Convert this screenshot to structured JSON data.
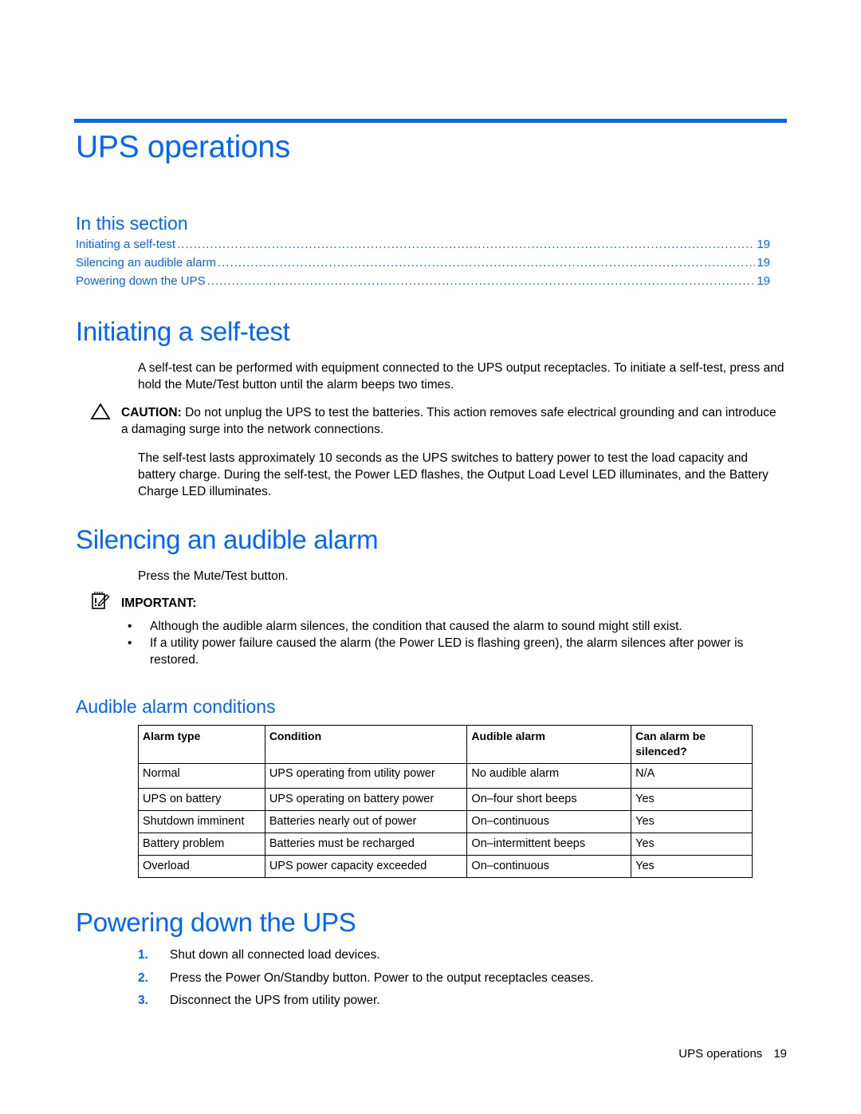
{
  "page": {
    "title": "UPS operations",
    "in_this_section": {
      "heading": "In this section",
      "entries": [
        {
          "label": "Initiating a self-test",
          "page": "19"
        },
        {
          "label": "Silencing an audible alarm",
          "page": "19"
        },
        {
          "label": "Powering down the UPS",
          "page": "19"
        }
      ]
    },
    "self_test": {
      "heading": "Initiating a self-test",
      "intro": "A self-test can be performed with equipment connected to the UPS output receptacles. To initiate a self-test, press and hold the Mute/Test button until the alarm beeps two times.",
      "caution_label": "CAUTION:",
      "caution_text": " Do not unplug the UPS to test the batteries. This action removes safe electrical grounding and can introduce a damaging surge into the network connections.",
      "details": "The self-test lasts approximately 10 seconds as the UPS switches to battery power to test the load capacity and battery charge. During the self-test, the Power LED flashes, the Output Load Level LED illuminates, and the Battery Charge LED illuminates."
    },
    "silencing": {
      "heading": "Silencing an audible alarm",
      "instruction": "Press the Mute/Test button.",
      "important_label": "IMPORTANT:",
      "bullets": [
        "Although the audible alarm silences, the condition that caused the alarm to sound might still exist.",
        "If a utility power failure caused the alarm (the Power LED is flashing green), the alarm silences after power is restored."
      ],
      "conditions": {
        "heading": "Audible alarm conditions",
        "columns": [
          "Alarm type",
          "Condition",
          "Audible alarm",
          "Can alarm be silenced?"
        ],
        "rows": [
          [
            "Normal",
            "UPS operating from utility power",
            "No audible alarm",
            "N/A"
          ],
          [
            "UPS on battery",
            "UPS operating on battery power",
            "On–four short beeps",
            "Yes"
          ],
          [
            "Shutdown imminent",
            "Batteries nearly out of power",
            "On–continuous",
            "Yes"
          ],
          [
            "Battery problem",
            "Batteries must be recharged",
            "On–intermittent beeps",
            "Yes"
          ],
          [
            "Overload",
            "UPS power capacity exceeded",
            "On–continuous",
            "Yes"
          ]
        ]
      }
    },
    "powering_down": {
      "heading": "Powering down the UPS",
      "steps": [
        {
          "num": "1.",
          "text": "Shut down all connected load devices."
        },
        {
          "num": "2.",
          "text": "Press the Power On/Standby button. Power to the output receptacles ceases."
        },
        {
          "num": "3.",
          "text": "Disconnect the UPS from utility power."
        }
      ]
    },
    "footer": {
      "section": "UPS operations",
      "page_number": "19"
    },
    "colors": {
      "accent": "#0066ff",
      "text": "#000000"
    }
  }
}
